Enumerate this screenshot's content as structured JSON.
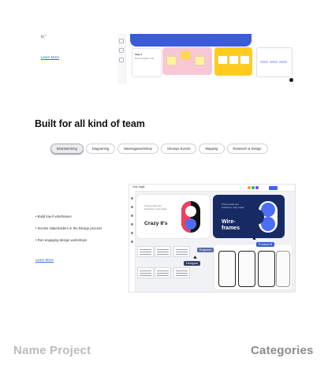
{
  "top_section": {
    "caption": "in.\"",
    "link": "Learn More",
    "board": {
      "card_title": "Step 2",
      "card_sub": "Pick one feature / link"
    }
  },
  "section": {
    "heading": "Built for all kind of team",
    "tabs": [
      {
        "label": "Brainstorming",
        "active": true
      },
      {
        "label": "Diagraming",
        "active": false
      },
      {
        "label": "Meeting&workshop",
        "active": false
      },
      {
        "label": "Strumps Events",
        "active": false
      },
      {
        "label": "Mapping",
        "active": false
      },
      {
        "label": "Research & Design",
        "active": false
      }
    ]
  },
  "features": {
    "items": [
      "Build low-fi wireframes",
      "Involve stakeholders in the Design process",
      "Run engaging design workshops"
    ],
    "link": "Learn More"
  },
  "app_preview": {
    "board_name": "Grid Jugle",
    "cards": {
      "crazy_title": "Crazy 8's",
      "crazy_sub": "Think quickly and brainstorm many ideas.",
      "wire_title_1": "Wire-",
      "wire_title_2": "frames",
      "wire_sub": "Think quickly and brainstorm many ideas."
    },
    "tags": {
      "engineer": "Engineer",
      "designer": "Designer",
      "product": "Product M"
    },
    "colors": {
      "accent": "#4263eb",
      "navy": "#182a63",
      "pink": "#f03e5f",
      "yellow": "#ffcc1d"
    }
  },
  "footer_labels": {
    "name_project": "Name Project",
    "categories": "Categories"
  }
}
